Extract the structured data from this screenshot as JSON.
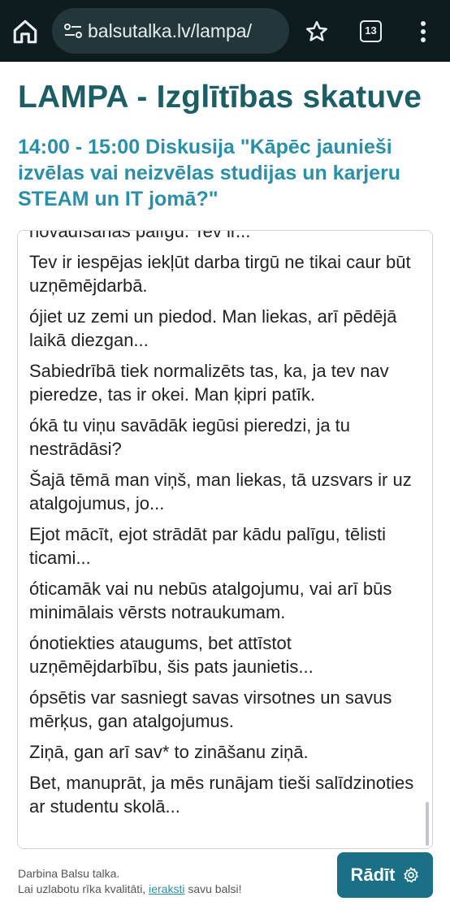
{
  "browser": {
    "url": "balsutalka.lv/lampa/",
    "tab_count": "13"
  },
  "page": {
    "title": "LAMPA - Izglītības skatuve",
    "session": "14:00 - 15:00 Diskusija \"Kāpēc jaunieši izvēlas vai neizvēlas studijas un karjeru STEAM un IT jomā?\""
  },
  "transcript": {
    "lines": [
      "novadīšanas palīgu. Tev ir...",
      "Tev ir iespējas iekļūt darba tirgū ne tikai caur būt uzņēmējdarbā.",
      "ójiet uz zemi un piedod. Man liekas, arī pēdējā laikā diezgan...",
      "Sabiedrībā tiek normalizēts tas, ka, ja tev nav pieredze, tas ir okei. Man ķipri patīk.",
      "ókā tu viņu savādāk iegūsi pieredzi, ja tu nestrādāsi?",
      "Šajā tēmā man viņš, man liekas, tā uzsvars ir uz atalgojumus, jo...",
      "Ejot mācīt, ejot strādāt par kādu palīgu, tēlisti ticami...",
      "óticamāk vai nu nebūs atalgojumu, vai arī būs minimālais vērsts notraukumam.",
      "ónotiekties ataugums, bet attīstot uzņēmējdarbību, šis pats jaunietis...",
      "ópsētis var sasniegt savas virsotnes un savus mērķus, gan atalgojumus.",
      "Ziņā, gan arī sav* to zināšanu ziņā.",
      "Bet, manuprāt, ja mēs runājam tieši salīdzinoties ar studentu skolā..."
    ]
  },
  "footer": {
    "line1": "Darbina Balsu talka.",
    "line2_prefix": "Lai uzlabotu rīka kvalitāti, ",
    "line2_link": "ieraksti",
    "line2_suffix": " savu balsi!"
  },
  "show_button": {
    "label": "Rādīt"
  }
}
